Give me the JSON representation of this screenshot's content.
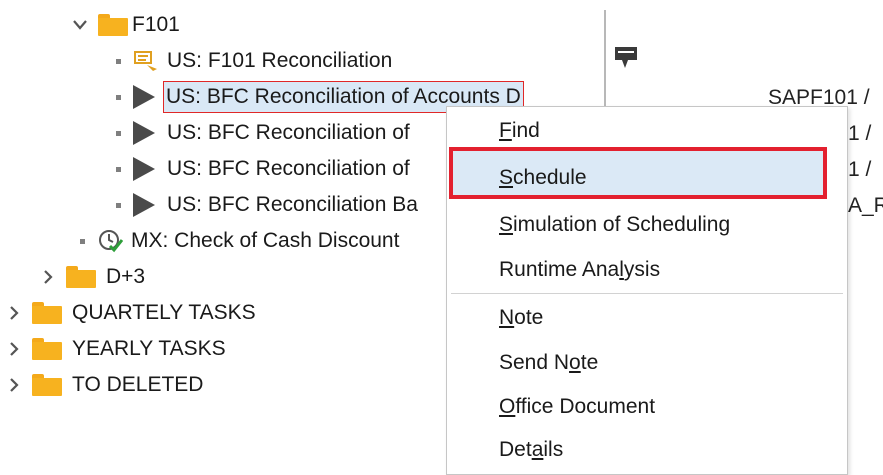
{
  "tree": {
    "folder_f101": "F101",
    "items": [
      "US: F101 Reconciliation",
      "US: BFC Reconciliation of Accounts D",
      "US: BFC Reconciliation of",
      "US: BFC Reconciliation of",
      "US: BFC Reconciliation Ba"
    ],
    "mx_item": "MX: Check of Cash Discount",
    "folders": [
      "D+3",
      "QUARTELY TASKS",
      "YEARLY TASKS",
      "TO DELETED"
    ]
  },
  "right_panel": {
    "lines": [
      "SAPF101 /",
      "1 /",
      "1 /",
      "A_R"
    ]
  },
  "context_menu": {
    "items": [
      {
        "pre": "",
        "u": "F",
        "post": "ind"
      },
      {
        "pre": "",
        "u": "S",
        "post": "chedule"
      },
      {
        "pre": "",
        "u": "S",
        "post": "imulation of Scheduling"
      },
      {
        "pre": "Runtime Ana",
        "u": "l",
        "post": "ysis"
      },
      {
        "pre": "",
        "u": "N",
        "post": "ote"
      },
      {
        "pre": "Send N",
        "u": "o",
        "post": "te"
      },
      {
        "pre": "",
        "u": "O",
        "post": "ffice Document"
      },
      {
        "pre": "Det",
        "u": "a",
        "post": "ils"
      }
    ]
  },
  "colors": {
    "folder": "#f7b21f",
    "selection": "#d9e8f6",
    "highlight_border": "#e3202f"
  }
}
